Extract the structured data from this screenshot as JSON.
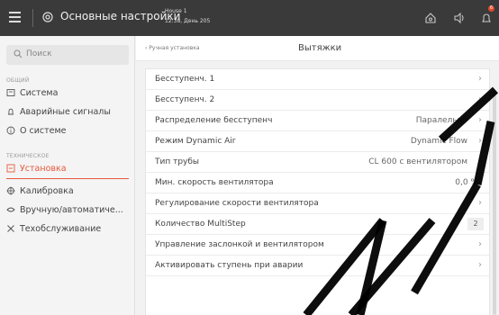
{
  "header": {
    "title": "Основные настройки",
    "house": "House 1",
    "status": "12:38, День 205",
    "badge": "6"
  },
  "sidebar": {
    "search_placeholder": "Поиск",
    "section_general": "ОБЩИЙ",
    "section_technical": "ТЕХНИЧЕСКОЕ",
    "items": [
      {
        "label": "Система",
        "icon": "system-icon"
      },
      {
        "label": "Аварийные сигналы",
        "icon": "alarm-icon"
      },
      {
        "label": "О системе",
        "icon": "info-icon"
      },
      {
        "label": "Установка",
        "icon": "installation-icon",
        "active": true
      },
      {
        "label": "Калибровка",
        "icon": "calibration-icon"
      },
      {
        "label": "Вручную/автоматиче...",
        "icon": "manual-auto-icon"
      },
      {
        "label": "Техобслуживание",
        "icon": "maintenance-icon"
      }
    ]
  },
  "main": {
    "breadcrumb": "‹  Ручная установка",
    "heading": "Вытяжки",
    "rows": [
      {
        "label": "Бесступенч. 1",
        "value": ""
      },
      {
        "label": "Бесступенч. 2",
        "value": ""
      },
      {
        "label": "Распределение бесступенч",
        "value": "Паралельно"
      },
      {
        "label": "Режим Dynamic Air",
        "value": "Dynamic Flow"
      },
      {
        "label": "Тип трубы",
        "value": "CL 600 с вентилятором"
      },
      {
        "label": "Мин. скорость вентилятора",
        "value": "0,0 %"
      },
      {
        "label": "Регулирование скорости вентилятора",
        "value": ""
      },
      {
        "label": "Количество MultiStep",
        "value": "2"
      },
      {
        "label": "Управление заслонкой и вентилятором",
        "value": ""
      },
      {
        "label": "Активировать ступень при аварии",
        "value": ""
      }
    ],
    "chevron": "›"
  },
  "colors": {
    "accent": "#e8573a",
    "topbar": "#3a3a3a"
  }
}
